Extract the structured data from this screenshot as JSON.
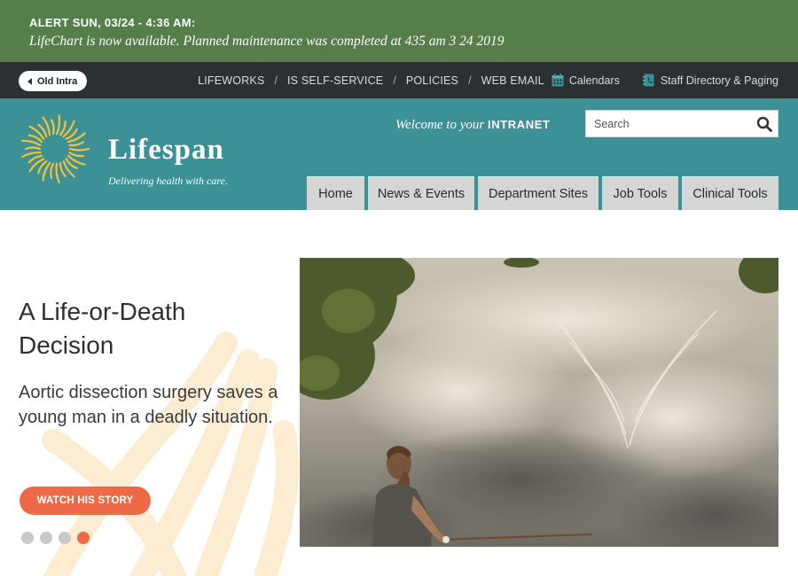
{
  "alert": {
    "title": "ALERT SUN, 03/24 - 4:36 AM:",
    "message": "LifeChart is now available. Planned maintenance was completed at 435 am 3 24 2019"
  },
  "utility": {
    "old_intra": "Old Intra",
    "links": [
      "LIFEWORKS",
      "IS SELF-SERVICE",
      "POLICIES",
      "WEB EMAIL"
    ],
    "separator": "/",
    "calendars": "Calendars",
    "staff_directory": "Staff Directory & Paging"
  },
  "header": {
    "brand": "Lifespan",
    "tagline": "Delivering health with care.",
    "welcome_prefix": "Welcome to your",
    "welcome_strong": "INTRANET",
    "search_placeholder": "Search",
    "nav": [
      "Home",
      "News & Events",
      "Department Sites",
      "Job Tools",
      "Clinical Tools"
    ]
  },
  "hero": {
    "title": "A Life-or-Death Decision",
    "subtitle": "Aortic dissection surgery saves a young man in a deadly situation.",
    "cta": "WATCH HIS STORY",
    "slide_count": 4,
    "active_slide": 4
  },
  "colors": {
    "alert_bg": "#557e4a",
    "utility_bg": "#2b3133",
    "header_bg": "#3c9197",
    "nav_tab_bg": "#d4d6d6",
    "accent": "#ec6a47",
    "logo_yellow": "#f2c23a"
  },
  "icons": {
    "old_intra": "back-arrow-icon",
    "calendar": "calendar-icon",
    "directory": "phone-book-icon",
    "search": "search-icon",
    "logo": "sun-logo-icon"
  }
}
